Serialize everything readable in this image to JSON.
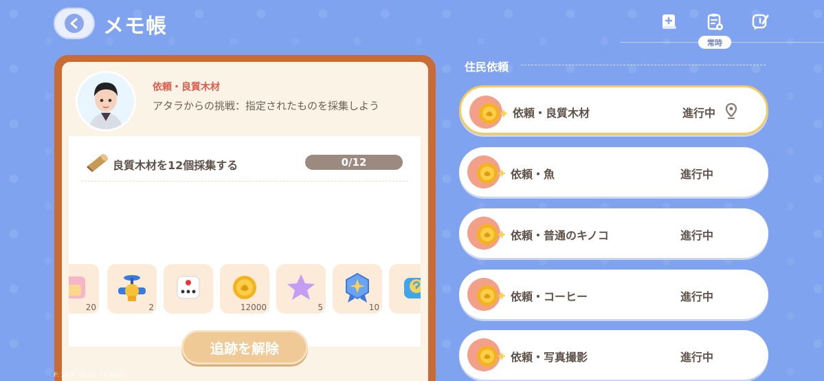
{
  "header": {
    "title": "メモ帳",
    "badge": "常時"
  },
  "quest": {
    "title": "依頼・良質木材",
    "description": "アタラからの挑戦：指定されたものを採集しよう",
    "task": {
      "label": "良質木材を12個採集する",
      "progress_text": "0/12",
      "progress": 0
    },
    "rewards": [
      {
        "icon": "pink-box-icon",
        "count": "20"
      },
      {
        "icon": "valve-icon",
        "count": "2"
      },
      {
        "icon": "dice-icon",
        "count": ""
      },
      {
        "icon": "gold-coin-icon",
        "count": "12000"
      },
      {
        "icon": "purple-star-icon",
        "count": "5"
      },
      {
        "icon": "medal-icon",
        "count": "10"
      },
      {
        "icon": "mystery-box-icon",
        "count": ""
      }
    ],
    "untrack_label": "追跡を解除"
  },
  "debug": {
    "text": "F: 30    P: 26    ID: 16cjeefq"
  },
  "requests": {
    "section_title": "住民依頼",
    "items": [
      {
        "name": "依頼・良質木材",
        "status": "進行中",
        "selected": true
      },
      {
        "name": "依頼・魚",
        "status": "進行中",
        "selected": false
      },
      {
        "name": "依頼・普通のキノコ",
        "status": "進行中",
        "selected": false
      },
      {
        "name": "依頼・コーヒー",
        "status": "進行中",
        "selected": false
      },
      {
        "name": "依頼・写真撮影",
        "status": "進行中",
        "selected": false
      }
    ]
  },
  "colors": {
    "background": "#7fa3ef",
    "card_frame": "#c96b35",
    "accent_red": "#e05a4b",
    "selected_border": "#f5c95c"
  }
}
